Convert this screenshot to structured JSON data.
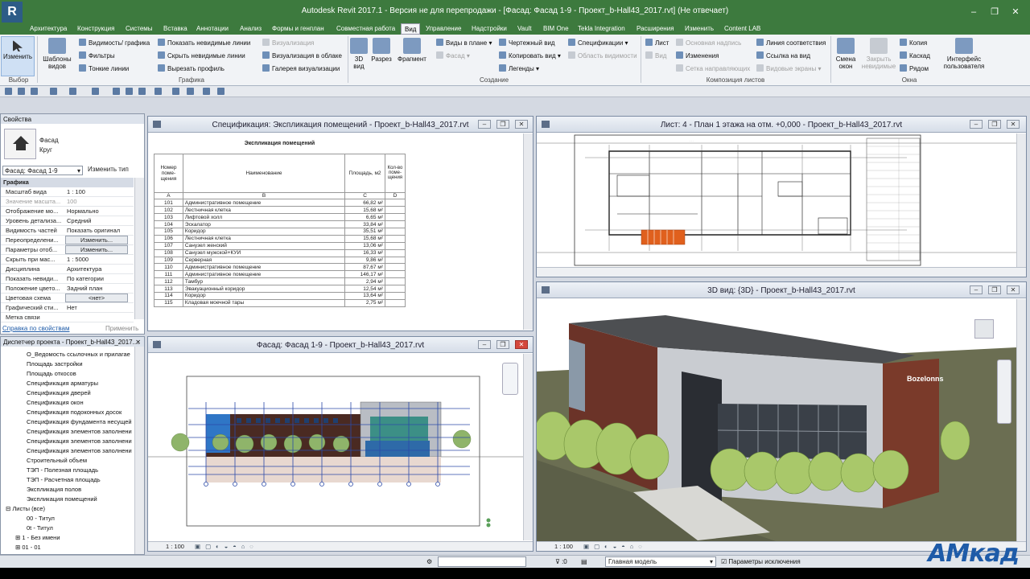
{
  "title": "Autodesk Revit 2017.1 - Версия не для перепродажи - [Фасад: Фасад 1-9 - Проект_b-Hall43_2017.rvt] (Не отвечает)",
  "app_logo": "R",
  "ribbon_tabs": [
    "Архитектура",
    "Конструкция",
    "Системы",
    "Вставка",
    "Аннотации",
    "Анализ",
    "Формы и генплан",
    "Совместная работа",
    "Вид",
    "Управление",
    "Надстройки",
    "Vault",
    "BIM One",
    "Tekla Integration",
    "Расширения",
    "Изменить",
    "Content LAB"
  ],
  "active_tab": "Вид",
  "ribbon": {
    "modify": "Изменить",
    "select": "Выбор",
    "templates": "Шаблоны видов",
    "visibility": "Видимость/ графика",
    "filters": "Фильтры",
    "thin_lines": "Тонкие линии",
    "show_hidden": "Показать невидимые линии",
    "remove_hidden": "Скрыть невидимые линии",
    "cut_profile": "Вырезать профиль",
    "render": "Визуализация",
    "render_cloud": "Визуализация в облаке",
    "render_gallery": "Галерея визуализации",
    "graphics": "Графика",
    "view3d": "3D вид",
    "section": "Разрез",
    "callout": "Фрагмент",
    "plan_views": "Виды в плане",
    "elevation": "Фасад",
    "drafting": "Чертежный вид",
    "duplicate": "Копировать вид",
    "legends": "Легенды",
    "schedules": "Спецификации",
    "scope_box": "Область видимости",
    "create": "Создание",
    "sheet": "Лист",
    "view": "Вид",
    "title_block": "Основная надпись",
    "revisions": "Изменения",
    "guide_grid": "Сетка направляющих",
    "matchline": "Линия соответствия",
    "view_ref": "Ссылка на вид",
    "viewports": "Видовые экраны",
    "sheet_comp": "Композиция листов",
    "switch_windows": "Смена окон",
    "close_hidden": "Закрыть невидимые",
    "replicate": "Копия",
    "cascade": "Каскад",
    "tile": "Рядом",
    "ui": "Интерфейс пользователя",
    "windows": "Окна"
  },
  "properties": {
    "header": "Свойства",
    "type_name": "Фасад",
    "type_sub": "Круг",
    "selector": "Фасад: Фасад 1-9",
    "edit_type": "Изменить тип",
    "group": "Графика",
    "rows": [
      {
        "k": "Масштаб вида",
        "v": "1 : 100"
      },
      {
        "k": "Значение масшта...",
        "v": "100"
      },
      {
        "k": "Отображение мо...",
        "v": "Нормально"
      },
      {
        "k": "Уровень детализа...",
        "v": "Средний"
      },
      {
        "k": "Видимость частей",
        "v": "Показать оригинал"
      },
      {
        "k": "Переопределени...",
        "v": "Изменить..."
      },
      {
        "k": "Параметры отоб...",
        "v": "Изменить..."
      },
      {
        "k": "Скрыть при мас...",
        "v": "1 : 5000"
      },
      {
        "k": "Дисциплина",
        "v": "Архитектура"
      },
      {
        "k": "Показать невиди...",
        "v": "По категории"
      },
      {
        "k": "Положение цвето...",
        "v": "Задний план"
      },
      {
        "k": "Цветовая схема",
        "v": "<нет>"
      },
      {
        "k": "Графический сти...",
        "v": "Нет"
      },
      {
        "k": "Метка связи",
        "v": ""
      }
    ],
    "help": "Справка по свойствам",
    "apply": "Применить"
  },
  "browser": {
    "header": "Диспетчер проекта - Проект_b-Hall43_2017....",
    "items": [
      "О_Ведомость ссылочных и прилагае",
      "Площадь застройки",
      "Площадь откосов",
      "Спецификация арматуры",
      "Спецификация дверей",
      "Спецификация окон",
      "Спецификация подоконных досок",
      "Спецификация фундамента несущей",
      "Спецификация элементов заполнени",
      "Спецификация элементов заполнени",
      "Спецификация элементов заполнени",
      "Строительный объем",
      "ТЭП - Полезная площадь",
      "ТЭП - Расчетная площадь",
      "Экспликация полов",
      "Экспликация помещений"
    ],
    "sheets_root": "Листы (все)",
    "sheets": [
      "00 - Титул",
      "0t - Титул",
      "1 - Без имени",
      "01 - 01"
    ]
  },
  "win_schedule": {
    "title": "Спецификация: Экспликация помещений - Проект_b-Hall43_2017.rvt",
    "table_title": "Экспликация помещений",
    "headers": [
      "Номер поме-щения",
      "Наименование",
      "Площадь, м2",
      "Кол-во поме-щения"
    ],
    "letters": [
      "A",
      "B",
      "C",
      "D"
    ],
    "rows": [
      [
        "101",
        "Административное помещение",
        "66,82 м²"
      ],
      [
        "102",
        "Лестничная клетка",
        "15,68 м²"
      ],
      [
        "103",
        "Лифтовой холл",
        "6,65 м²"
      ],
      [
        "104",
        "Эскалатор",
        "33,84 м²"
      ],
      [
        "105",
        "Коридор",
        "35,51 м²"
      ],
      [
        "106",
        "Лестничная клетка",
        "15,68 м²"
      ],
      [
        "107",
        "Санузел женский",
        "13,06 м²"
      ],
      [
        "108",
        "Санузел мужской+КУИ",
        "16,33 м²"
      ],
      [
        "109",
        "Серверная",
        "9,86 м²"
      ],
      [
        "110",
        "Административное помещение",
        "87,67 м²"
      ],
      [
        "111",
        "Административное помещение",
        "146,17 м²"
      ],
      [
        "112",
        "Тамбур",
        "2,94 м²"
      ],
      [
        "113",
        "Эвакуационный коридор",
        "12,54 м²"
      ],
      [
        "114",
        "Коридор",
        "13,64 м²"
      ],
      [
        "115",
        "Кладовая моечной тары",
        "2,75 м²"
      ]
    ]
  },
  "win_sheet": {
    "title": "Лист: 4 - План 1 этажа на отм. +0,000 - Проект_b-Hall43_2017.rvt"
  },
  "win_elev": {
    "title": "Фасад: Фасад 1-9 - Проект_b-Hall43_2017.rvt",
    "scale": "1 : 100"
  },
  "win_3d": {
    "title": "3D вид: {3D} - Проект_b-Hall43_2017.rvt",
    "scale": "1 : 100",
    "sign": "Bozelonns"
  },
  "status": {
    "coord": ":0",
    "model": "Главная модель",
    "exclude": "Параметры исключения"
  },
  "watermark": "АМкад",
  "colors": {
    "titlebar": "#3d7a3e",
    "sky": "#ffffff",
    "ground": "#6b6e52",
    "brick": "#6b3328",
    "tree": "#a9c86a"
  }
}
